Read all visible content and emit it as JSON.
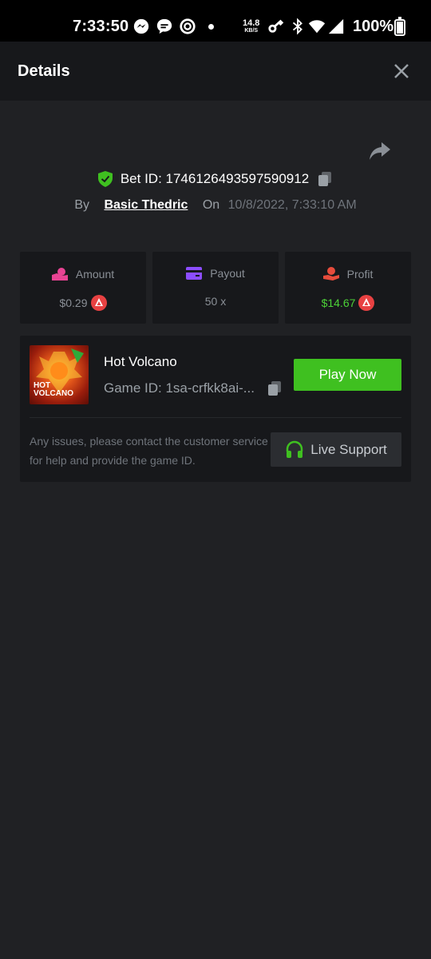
{
  "status_bar": {
    "time": "7:33:50",
    "net_speed": "14.8",
    "net_unit": "KB/S",
    "battery": "100%",
    "icons": [
      "messenger-icon",
      "chat-icon",
      "circle-app-icon",
      "key-icon",
      "bluetooth-icon",
      "wifi-icon",
      "signal-icon",
      "battery-charging-icon"
    ]
  },
  "header": {
    "title": "Details",
    "close_icon": "close-icon"
  },
  "bet": {
    "id_label": "Bet ID: 1746126493597590912",
    "by_label": "By",
    "user": "Basic Thedric",
    "on_label": "On",
    "date": "10/8/2022, 7:33:10 AM"
  },
  "stats": {
    "amount": {
      "label": "Amount",
      "value": "$0.29",
      "icon": "money-bag-icon",
      "color": "#e84393"
    },
    "payout": {
      "label": "Payout",
      "value": "50 x",
      "icon": "card-icon",
      "color": "#8c4dff"
    },
    "profit": {
      "label": "Profit",
      "value": "$14.67",
      "icon": "hand-coin-icon",
      "color": "#e74c3c"
    }
  },
  "game": {
    "name": "Hot Volcano",
    "thumb_text_1": "HOT",
    "thumb_text_2": "VOLCANO",
    "id_label": "Game ID: 1sa-crfkk8ai-...",
    "play_label": "Play Now",
    "help_text": "Any issues, please contact the customer service for help and provide the game ID.",
    "support_label": "Live Support"
  },
  "colors": {
    "accent_green": "#3fc020",
    "profit_green": "#4cd137",
    "background": "#202124",
    "card": "#17181b"
  }
}
